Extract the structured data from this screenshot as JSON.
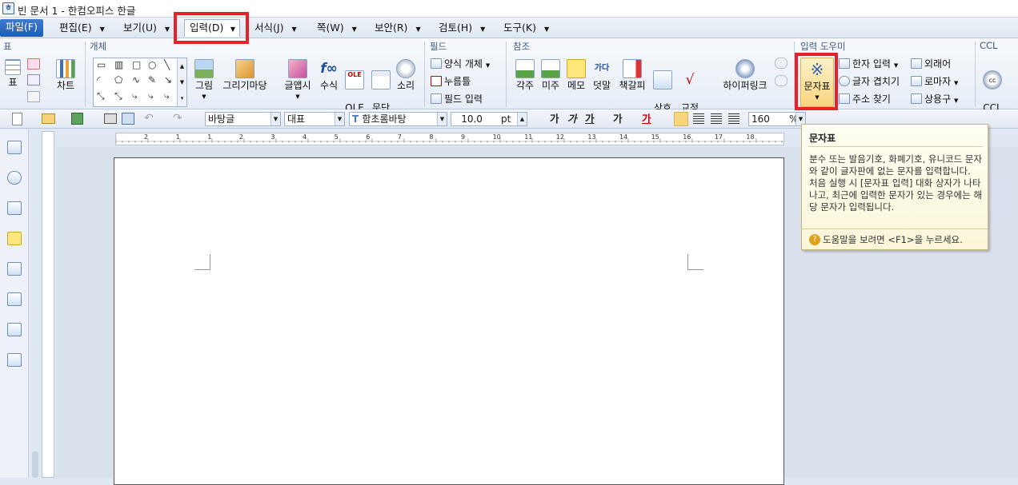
{
  "title": "빈 문서 1 - 한컴오피스 한글",
  "menus": {
    "file": "파일(F)",
    "edit": "편집(E)",
    "view": "보기(U)",
    "input": "입력(D)",
    "format": "서식(J)",
    "page": "쪽(W)",
    "security": "보안(R)",
    "review": "검토(H)",
    "tools": "도구(K)"
  },
  "ribbon": {
    "groups": {
      "table": "표",
      "object": "개체",
      "field": "필드",
      "reference": "참조",
      "input_helper": "입력 도우미",
      "ccl": "CCL"
    },
    "table_btn": "표",
    "chart_btn": "차트",
    "picture_btn": "그림",
    "drawing_btn": "그리기마당",
    "wordart_btn": "글맵시",
    "formula_btn": "수식",
    "ole_btn": "OLE\n개체",
    "para_btn": "문단\n띠",
    "sound_btn": "소리",
    "form_obj": "양식 개체",
    "click_here": "누름틀",
    "field_input": "필드 입력",
    "footnote": "각주",
    "endnote": "미주",
    "memo": "메모",
    "overlap": "덧말",
    "bookmark": "책갈피",
    "cross_ref": "상호\n참조",
    "proof": "교정\n부호",
    "hyperlink": "하이퍼링크",
    "charmap": "문자표",
    "hanja": "한자 입력",
    "overlay": "글자 겹치기",
    "address": "주소 찾기",
    "foreign": "외래어",
    "roman": "로마자",
    "phrases": "상용구",
    "ccl_btn": "CCL\n넣기"
  },
  "toolbar": {
    "style": "바탕글",
    "lang": "대표",
    "font": "함초롬바탕",
    "size": "10.0",
    "unit": "pt",
    "bold": "가",
    "italic": "가",
    "underline": "가",
    "spacing": "가",
    "color": "가",
    "line_spacing": "160",
    "percent": "%"
  },
  "ruler_numbers": [
    "2",
    "1",
    "1",
    "2",
    "3",
    "4",
    "5",
    "6",
    "7",
    "8",
    "9",
    "10",
    "11",
    "12",
    "13",
    "14",
    "15",
    "16",
    "17",
    "18"
  ],
  "tooltip": {
    "title": "문자표",
    "body": "분수 또는 발음기호, 화폐기호, 유니코드 문자와 같이 글자판에 없는 문자를 입력합니다.\n처음 실행 시 [문자표 입력] 대화 상자가 나타나고, 최근에 입력한 문자가 있는 경우에는 해당 문자가 입력됩니다.",
    "footer": "도움말을 보려면 <F1>을 누르세요."
  },
  "colors": {
    "highlight": "#e8202a",
    "file_tab": "#1e5cb3",
    "tooltip_bg": "#fffff3"
  }
}
